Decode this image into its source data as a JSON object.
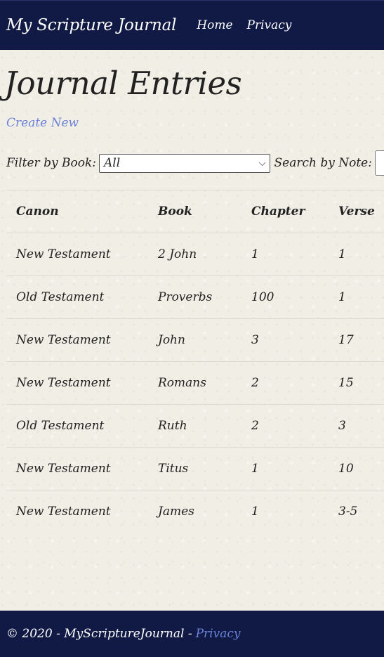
{
  "nav": {
    "brand": "My Scripture Journal",
    "home": "Home",
    "privacy": "Privacy"
  },
  "main": {
    "title": "Journal Entries",
    "create_new": "Create New",
    "filter_label": "Filter by Book:",
    "filter_value": "All",
    "search_label": "Search by Note:",
    "search_value": ""
  },
  "table": {
    "headers": [
      "Canon",
      "Book",
      "Chapter",
      "Verse"
    ],
    "rows": [
      [
        "New Testament",
        "2 John",
        "1",
        "1"
      ],
      [
        "Old Testament",
        "Proverbs",
        "100",
        "1"
      ],
      [
        "New Testament",
        "John",
        "3",
        "17"
      ],
      [
        "New Testament",
        "Romans",
        "2",
        "15"
      ],
      [
        "Old Testament",
        "Ruth",
        "2",
        "3"
      ],
      [
        "New Testament",
        "Titus",
        "1",
        "10"
      ],
      [
        "New Testament",
        "James",
        "1",
        "3-5"
      ]
    ]
  },
  "footer": {
    "copyright": "© 2020 - MyScriptureJournal -",
    "privacy": "Privacy"
  },
  "colors": {
    "navbar": "#101a45",
    "link": "#6b82d9",
    "background": "#f1eee5"
  }
}
